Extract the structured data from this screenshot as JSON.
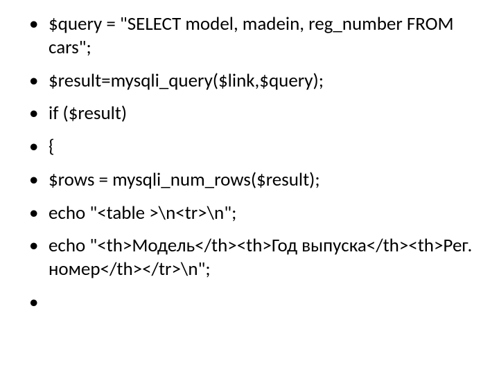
{
  "bullets": [
    {
      "text": "$query = \"SELECT model, madein, reg_number FROM  cars\";",
      "indent": false
    },
    {
      "text": "$result=mysqli_query($link,$query);",
      "indent": false
    },
    {
      "text": "if ($result)",
      "indent": false
    },
    {
      "text": "{",
      "indent": false
    },
    {
      "text": " $rows = mysqli_num_rows($result);",
      "indent": true
    },
    {
      "text": " echo \"<table >\\n<tr>\\n\";",
      "indent": true
    },
    {
      "text": " echo \"<th>Модель</th><th>Год выпуска</th><th>Рег. номер</th></tr>\\n\";",
      "indent": true
    },
    {
      "text": "",
      "indent": false
    }
  ]
}
